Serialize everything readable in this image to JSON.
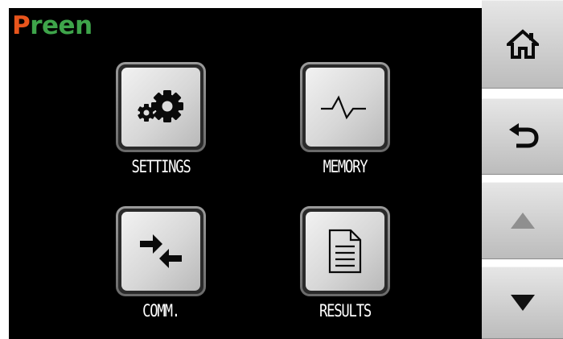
{
  "brand": {
    "initial": "P",
    "rest": "reen",
    "colors": {
      "initial": "#e8551c",
      "rest": "#3ea44a"
    }
  },
  "menu": {
    "settings": {
      "label": "SETTINGS",
      "icon": "gears-icon"
    },
    "memory": {
      "label": "MEMORY",
      "icon": "waveform-icon"
    },
    "comm": {
      "label": "COMM.",
      "icon": "transfer-arrows-icon"
    },
    "results": {
      "label": "RESULTS",
      "icon": "document-icon"
    }
  },
  "sidebar": {
    "home": {
      "icon": "home-icon"
    },
    "back": {
      "icon": "back-arrow-icon"
    },
    "up": {
      "icon": "up-triangle-icon",
      "enabled": false
    },
    "down": {
      "icon": "down-triangle-icon",
      "enabled": true
    }
  },
  "colors": {
    "screen_background": "#000000",
    "label_text": "#ffffff",
    "disabled_arrow": "#8f8f8f",
    "enabled_arrow": "#111111"
  }
}
